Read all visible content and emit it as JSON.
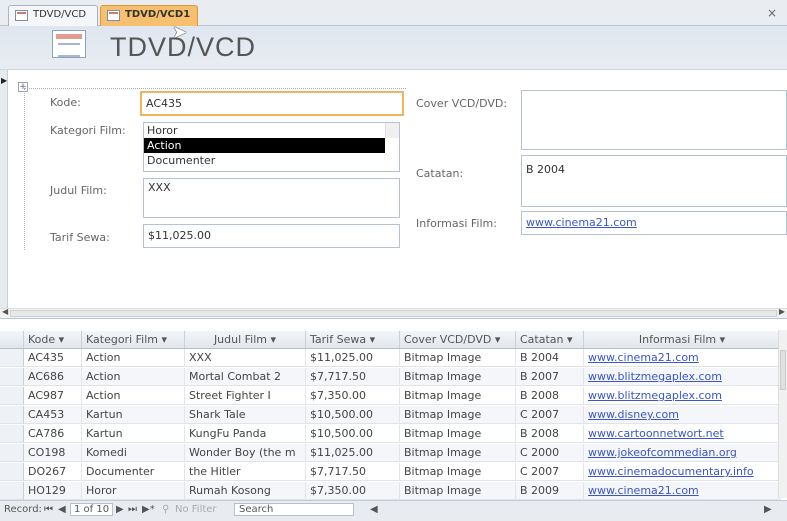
{
  "tabs": [
    {
      "label": "TDVD/VCD"
    },
    {
      "label": "TDVD/VCD1"
    }
  ],
  "close_symbol": "×",
  "form": {
    "title": "TDVD/VCD",
    "fields": {
      "kode_label": "Kode:",
      "kode_value": "AC435",
      "kategori_label": "Kategori Film:",
      "kategori_options": [
        "Horor",
        "Action",
        "Documenter"
      ],
      "kategori_selected": "Action",
      "judul_label": "Judul Film:",
      "judul_value": "XXX",
      "tarif_label": "Tarif Sewa:",
      "tarif_value": "$11,025.00",
      "cover_label": "Cover VCD/DVD:",
      "catatan_label": "Catatan:",
      "catatan_value": "B 2004",
      "info_label": "Informasi Film:",
      "info_value": "www.cinema21.com"
    }
  },
  "datasheet": {
    "columns": [
      "Kode",
      "Kategori Film",
      "Judul Film",
      "Tarif Sewa",
      "Cover VCD/DVD",
      "Catatan",
      "Informasi Film"
    ],
    "rows": [
      [
        "AC435",
        "Action",
        "XXX",
        "$11,025.00",
        "Bitmap Image",
        "B 2004",
        "www.cinema21.com"
      ],
      [
        "AC686",
        "Action",
        "Mortal Combat 2",
        "$7,717.50",
        "Bitmap Image",
        "B 2007",
        "www.blitzmegaplex.com"
      ],
      [
        "AC987",
        "Action",
        "Street Fighter I",
        "$7,350.00",
        "Bitmap Image",
        "B 2008",
        "www.blitzmegaplex.com"
      ],
      [
        "CA453",
        "Kartun",
        "Shark Tale",
        "$10,500.00",
        "Bitmap Image",
        "C 2007",
        "www.disney.com"
      ],
      [
        "CA786",
        "Kartun",
        "KungFu Panda",
        "$10,500.00",
        "Bitmap Image",
        "B 2008",
        "www.cartoonnetwort.net"
      ],
      [
        "CO198",
        "Komedi",
        "Wonder Boy (the m",
        "$11,025.00",
        "Bitmap Image",
        "C 2000",
        "www.jokeofcommedian.org"
      ],
      [
        "DO267",
        "Documenter",
        "the Hitler",
        "$7,717.50",
        "Bitmap Image",
        "C 2007",
        "www.cinemadocumentary.info"
      ],
      [
        "HO129",
        "Horor",
        "Rumah Kosong",
        "$7,350.00",
        "Bitmap Image",
        "B 2009",
        "www.cinema21.com"
      ]
    ]
  },
  "navigation": {
    "record_label": "Record:",
    "position": "1 of 10",
    "filter_label": "No Filter",
    "search_label": "Search"
  },
  "icons": [
    "form-icon",
    "expand-icon",
    "record-pointer-icon",
    "first-record-icon",
    "prev-record-icon",
    "next-record-icon",
    "last-record-icon",
    "new-record-icon",
    "filter-icon"
  ]
}
